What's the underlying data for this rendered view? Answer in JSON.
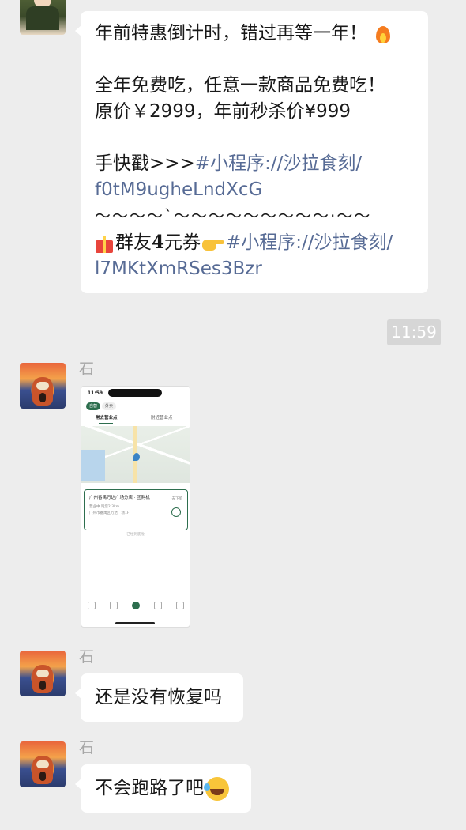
{
  "messages": [
    {
      "sender": "",
      "lines": [
        "年前特惠倒计时，错过再等一年！",
        "",
        "全年免费吃，任意一款商品免费吃！",
        "原价￥2999，年前秒杀价¥999",
        "",
        "手快戳>>>",
        "#小程序://沙拉食刻/",
        "f0tM9ugheLndXcG",
        "～～～～`～～～～～～～～～·～～",
        "群友",
        "4",
        "元券",
        "#小程序://沙拉食刻/",
        "l7MKtXmRSes3Bzr"
      ],
      "emojis": [
        "fire-icon",
        "gift-icon",
        "pointing-hand-icon"
      ]
    },
    {
      "time": "11:59"
    },
    {
      "sender": "石",
      "image": {
        "status_time": "11:59",
        "pill_1": "自营",
        "pill_2": "外卖",
        "tab_1": "常去营业点",
        "tab_2": "附近营业点",
        "store_name": "广州番禺万达广场分店 · 团购机",
        "store_line_1": "营业中 距您2.3km",
        "store_line_2": "广州市番禺区万达广场1F",
        "store_right": "去下单",
        "more": "— 已经到底啦 —",
        "accent": "#2d6e4e"
      }
    },
    {
      "sender": "石",
      "text": "还是没有恢复吗"
    },
    {
      "sender": "石",
      "text": "不会跑路了吧",
      "emoji": "face-with-tears-of-joy-icon"
    }
  ],
  "colors": {
    "background": "#ededed",
    "bubble": "#ffffff",
    "link": "#576b95",
    "sender": "#a6a6a6",
    "time_badge": "#d6d6d6"
  }
}
